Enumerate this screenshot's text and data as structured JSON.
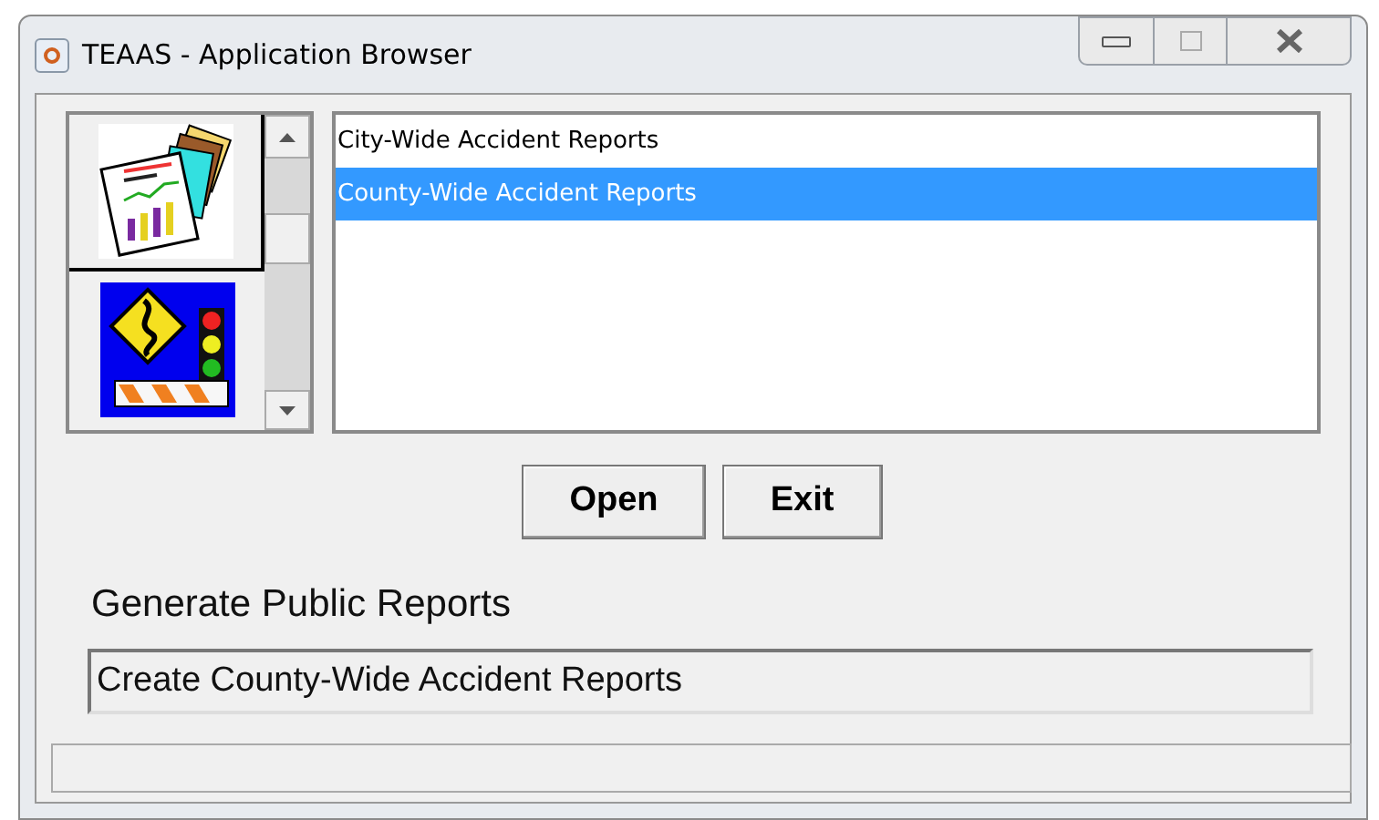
{
  "window": {
    "title": "TEAAS - Application Browser"
  },
  "applications": [
    {
      "kind": "reports",
      "selected": true
    },
    {
      "kind": "traffic",
      "selected": false
    }
  ],
  "reports": [
    {
      "label": "City-Wide Accident Reports",
      "selected": false
    },
    {
      "label": "County-Wide Accident Reports",
      "selected": true
    }
  ],
  "buttons": [
    "Open",
    "Exit"
  ],
  "application_name": "Generate Public Reports",
  "description": {
    "value": "Create County-Wide Accident Reports"
  }
}
